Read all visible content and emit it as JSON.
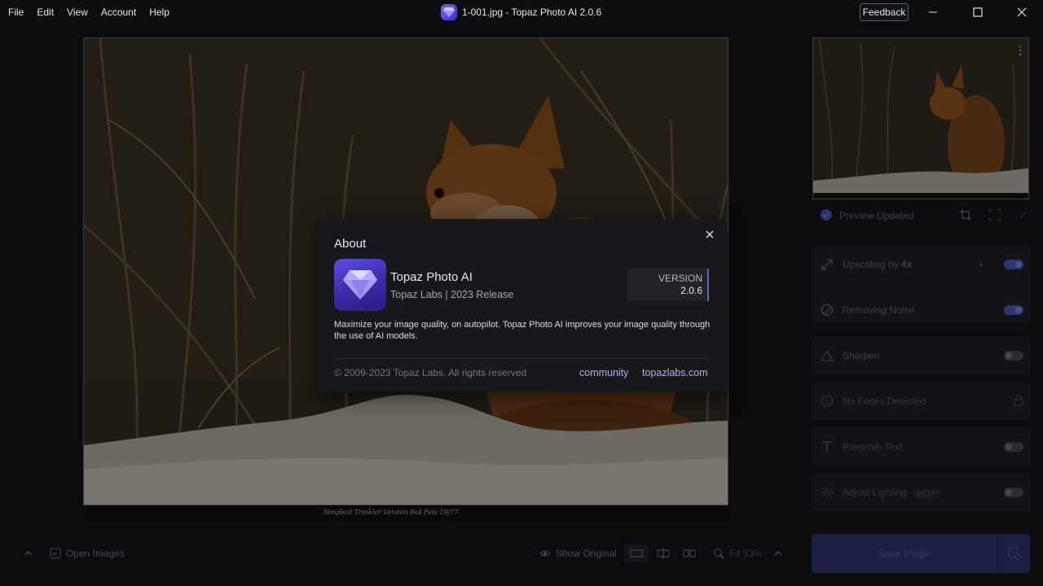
{
  "menu": [
    "File",
    "Edit",
    "View",
    "Account",
    "Help"
  ],
  "window": {
    "title": "1-001.jpg - Topaz Photo AI 2.0.6",
    "feedback_label": "Feedback"
  },
  "photo": {
    "caption": "Simplest Trinkler Version   8x4 Fels 19/77"
  },
  "side_panel": {
    "preview_status": "Preview Updated",
    "features": [
      {
        "label": "Upscaling by",
        "value": "4x",
        "enabled": true
      },
      {
        "label": "Removing Noise",
        "enabled": true
      },
      {
        "label": "Sharpen",
        "enabled": false
      },
      {
        "label": "No Faces Detected",
        "enabled": false
      },
      {
        "label": "Preserve Text",
        "enabled": false
      },
      {
        "label": "Adjust Lighting",
        "badge": "BETA",
        "enabled": false
      }
    ]
  },
  "bottom_bar": {
    "open_images": "Open Images",
    "show_original": "Show Original",
    "zoom": "Fit 33%",
    "save_image": "Save Image"
  },
  "about_dialog": {
    "title": "About",
    "app_name": "Topaz Photo AI",
    "vendor": "Topaz Labs | 2023 Release",
    "version_label": "VERSION",
    "version_number": "2.0.6",
    "description": "Maximize your image quality, on autopilot. Topaz Photo AI improves your image quality through the use of AI models.",
    "copyright": "© 2009-2023 Topaz Labs. All rights reserved",
    "links": [
      "community",
      "topazlabs.com"
    ]
  },
  "colors": {
    "accent": "#5a63d6",
    "link": "#aeb4f2",
    "dialog_bg": "#17181b",
    "app_bg": "#0b0c0e"
  }
}
